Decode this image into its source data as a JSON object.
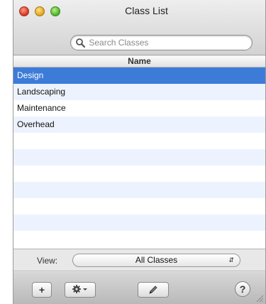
{
  "window": {
    "title": "Class List"
  },
  "search": {
    "placeholder": "Search Classes"
  },
  "table": {
    "column_header": "Name",
    "rows": [
      "Design",
      "Landscaping",
      "Maintenance",
      "Overhead",
      "",
      "",
      "",
      "",
      "",
      "",
      ""
    ],
    "selected_index": 0
  },
  "view": {
    "label": "View:",
    "selected": "All Classes"
  },
  "toolbar": {
    "add_label": "+",
    "help_label": "?"
  },
  "colors": {
    "selection": "#3d7bd9",
    "stripe": "#edf3fe"
  }
}
